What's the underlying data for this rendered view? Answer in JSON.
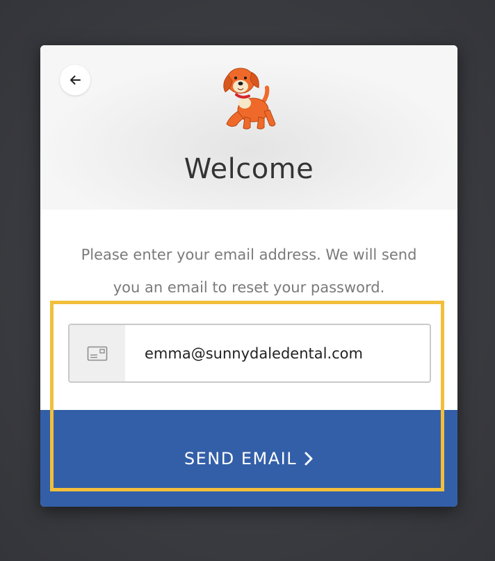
{
  "header": {
    "title": "Welcome",
    "back_icon": "arrow-left-icon",
    "logo": "dog-mascot-logo"
  },
  "form": {
    "instructions": "Please enter your email address. We will send you an email to reset your password.",
    "email_icon": "envelope-icon",
    "email_value": "emma@sunnydaledental.com",
    "send_label": "SEND EMAIL",
    "send_icon": "chevron-right-icon"
  },
  "colors": {
    "primary_button": "#335fa8",
    "highlight": "#f2bf3b",
    "mascot": "#ef6a2a"
  }
}
